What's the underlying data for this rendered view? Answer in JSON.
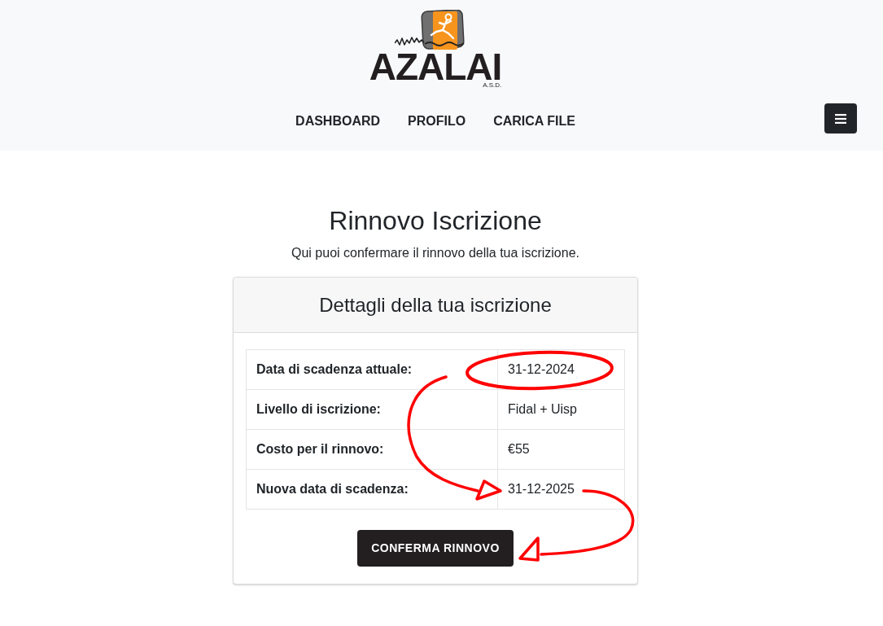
{
  "header": {
    "logo": {
      "name": "AZALAI",
      "tagline": "A.S.D."
    },
    "nav": {
      "items": [
        {
          "label": "DASHBOARD"
        },
        {
          "label": "PROFILO"
        },
        {
          "label": "CARICA FILE"
        }
      ]
    }
  },
  "page": {
    "title": "Rinnovo Iscrizione",
    "subtitle": "Qui puoi confermare il rinnovo della tua iscrizione."
  },
  "card": {
    "title": "Dettagli della tua iscrizione",
    "rows": [
      {
        "label": "Data di scadenza attuale:",
        "value": "31-12-2024"
      },
      {
        "label": "Livello di iscrizione:",
        "value": "Fidal + Uisp"
      },
      {
        "label": "Costo per il rinnovo:",
        "value": "€55"
      },
      {
        "label": "Nuova data di scadenza:",
        "value": "31-12-2025"
      }
    ],
    "button": {
      "label": "CONFERMA RINNOVO"
    }
  },
  "annotations": [
    {
      "kind": "ellipse"
    },
    {
      "kind": "arrow"
    },
    {
      "kind": "arrow"
    }
  ]
}
